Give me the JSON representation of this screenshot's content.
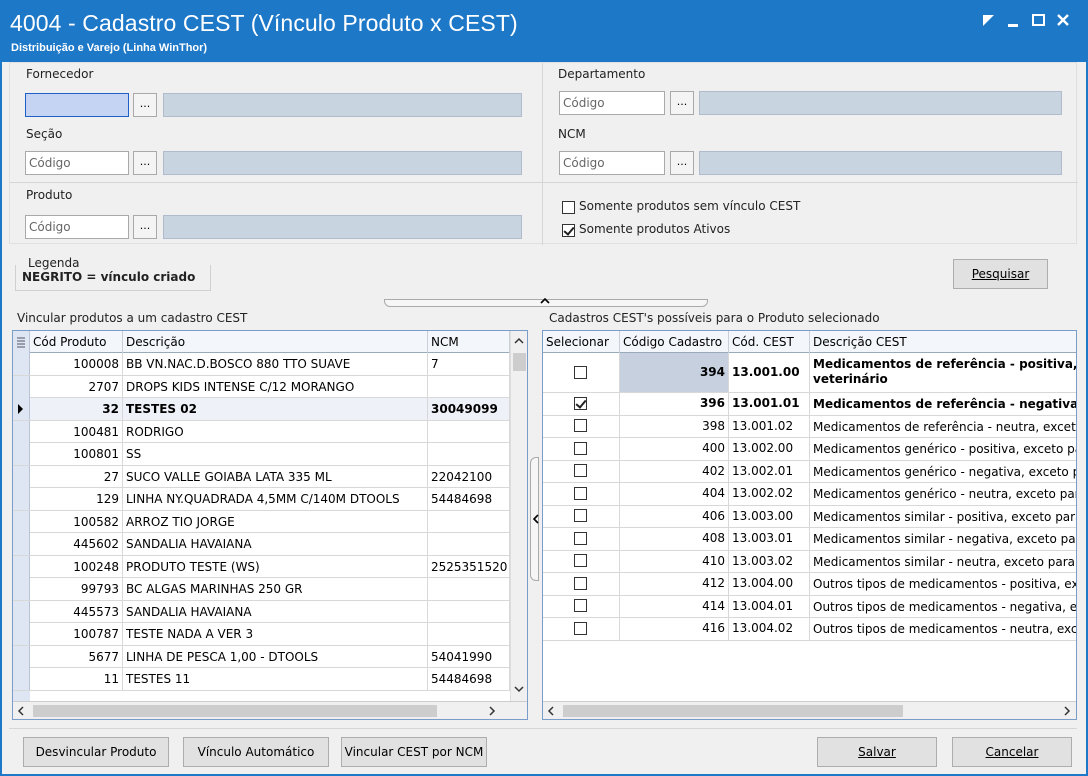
{
  "window": {
    "title": "4004 - Cadastro CEST (Vínculo Produto x CEST)",
    "subtitle": "Distribuição e Varejo (Linha WinThor)"
  },
  "filters": {
    "fornecedor_label": "Fornecedor",
    "departamento_label": "Departamento",
    "secao_label": "Seção",
    "ncm_label": "NCM",
    "produto_label": "Produto",
    "codigo_placeholder": "Código",
    "ellipsis": "...",
    "sem_vinculo_label": "Somente produtos sem vínculo CEST",
    "sem_vinculo_checked": false,
    "ativos_label": "Somente produtos Ativos",
    "ativos_checked": true
  },
  "legend": {
    "title": "Legenda",
    "text": "NEGRITO = vínculo criado"
  },
  "search_button": "Pesquisar",
  "products": {
    "group_label": "Vincular produtos a um cadastro CEST",
    "headers": {
      "code": "Cód Produto",
      "desc": "Descrição",
      "ncm": "NCM"
    },
    "rows": [
      {
        "code": "100008",
        "desc": "BB VN.NAC.D.BOSCO 880 TTO SUAVE",
        "ncm": "7",
        "bold": false,
        "current": false
      },
      {
        "code": "2707",
        "desc": "DROPS KIDS INTENSE C/12 MORANGO",
        "ncm": "",
        "bold": false,
        "current": false
      },
      {
        "code": "32",
        "desc": "TESTES 02",
        "ncm": "30049099",
        "bold": true,
        "current": true
      },
      {
        "code": "100481",
        "desc": "RODRIGO",
        "ncm": "",
        "bold": false,
        "current": false
      },
      {
        "code": "100801",
        "desc": "SS",
        "ncm": "",
        "bold": false,
        "current": false
      },
      {
        "code": "27",
        "desc": "SUCO VALLE GOIABA LATA 335 ML",
        "ncm": "22042100",
        "bold": false,
        "current": false
      },
      {
        "code": "129",
        "desc": "LINHA NY.QUADRADA 4,5MM C/140M DTOOLS",
        "ncm": "54484698",
        "bold": false,
        "current": false
      },
      {
        "code": "100582",
        "desc": "ARROZ TIO JORGE",
        "ncm": "",
        "bold": false,
        "current": false
      },
      {
        "code": "445602",
        "desc": "SANDALIA HAVAIANA",
        "ncm": "",
        "bold": false,
        "current": false
      },
      {
        "code": "100248",
        "desc": "PRODUTO TESTE (WS)",
        "ncm": "2525351520",
        "bold": false,
        "current": false
      },
      {
        "code": "99793",
        "desc": "BC ALGAS MARINHAS 250 GR",
        "ncm": "",
        "bold": false,
        "current": false
      },
      {
        "code": "445573",
        "desc": "SANDALIA HAVAIANA",
        "ncm": "",
        "bold": false,
        "current": false
      },
      {
        "code": "100787",
        "desc": "TESTE NADA A VER 3",
        "ncm": "",
        "bold": false,
        "current": false
      },
      {
        "code": "5677",
        "desc": "LINHA DE PESCA 1,00 - DTOOLS",
        "ncm": "54041990",
        "bold": false,
        "current": false
      },
      {
        "code": "11",
        "desc": "TESTES 11",
        "ncm": "54484698",
        "bold": false,
        "current": false
      }
    ]
  },
  "cest": {
    "group_label": "Cadastros CEST's possíveis para o Produto selecionado",
    "headers": {
      "sel": "Selecionar",
      "code": "Código Cadastro",
      "cest": "Cód. CEST",
      "desc": "Descrição CEST"
    },
    "rows": [
      {
        "checked": false,
        "code": "394",
        "cest": "13.001.00",
        "desc": "Medicamentos de referência - positiva,",
        "desc2": "veterinário",
        "bold": true,
        "current": true
      },
      {
        "checked": true,
        "code": "396",
        "cest": "13.001.01",
        "desc": "Medicamentos de referência - negativa",
        "bold": true,
        "current": false
      },
      {
        "checked": false,
        "code": "398",
        "cest": "13.001.02",
        "desc": "Medicamentos de referência - neutra, exceto",
        "bold": false,
        "current": false
      },
      {
        "checked": false,
        "code": "400",
        "cest": "13.002.00",
        "desc": "Medicamentos genérico - positiva, exceto para",
        "bold": false,
        "current": false
      },
      {
        "checked": false,
        "code": "402",
        "cest": "13.002.01",
        "desc": "Medicamentos genérico - negativa, exceto para",
        "bold": false,
        "current": false
      },
      {
        "checked": false,
        "code": "404",
        "cest": "13.002.02",
        "desc": "Medicamentos genérico - neutra, exceto para",
        "bold": false,
        "current": false
      },
      {
        "checked": false,
        "code": "406",
        "cest": "13.003.00",
        "desc": "Medicamentos similar - positiva, exceto para",
        "bold": false,
        "current": false
      },
      {
        "checked": false,
        "code": "408",
        "cest": "13.003.01",
        "desc": "Medicamentos similar - negativa, exceto para",
        "bold": false,
        "current": false
      },
      {
        "checked": false,
        "code": "410",
        "cest": "13.003.02",
        "desc": "Medicamentos similar - neutra, exceto para",
        "bold": false,
        "current": false
      },
      {
        "checked": false,
        "code": "412",
        "cest": "13.004.00",
        "desc": "Outros tipos de medicamentos - positiva, exceto",
        "bold": false,
        "current": false
      },
      {
        "checked": false,
        "code": "414",
        "cest": "13.004.01",
        "desc": "Outros tipos de medicamentos -  negativa, exceto",
        "bold": false,
        "current": false
      },
      {
        "checked": false,
        "code": "416",
        "cest": "13.004.02",
        "desc": "Outros tipos de medicamentos - neutra, exceto",
        "bold": false,
        "current": false
      }
    ]
  },
  "footer": {
    "desvincular": "Desvincular Produto",
    "automatico": "Vínculo Automático",
    "por_ncm": "Vincular CEST por NCM",
    "salvar": "Salvar",
    "cancelar": "Cancelar"
  }
}
